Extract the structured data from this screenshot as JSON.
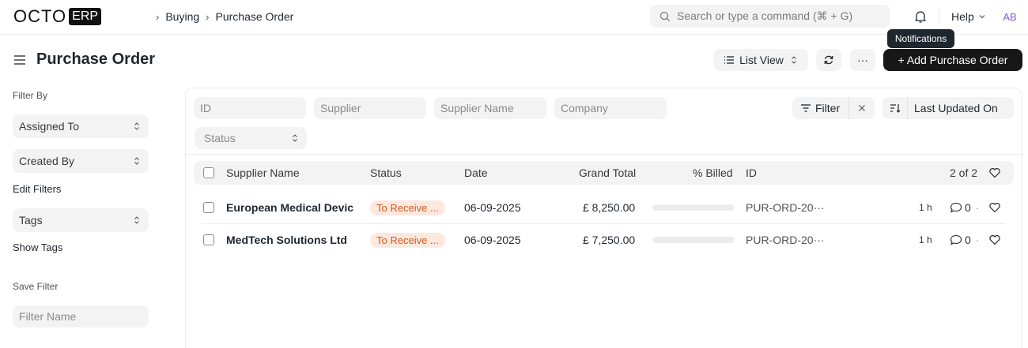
{
  "navbar": {
    "logo_text": "OCTO",
    "logo_badge": "ERP",
    "breadcrumbs": [
      "Buying",
      "Purchase Order"
    ],
    "search_placeholder": "Search or type a command (⌘ + G)",
    "help_label": "Help",
    "avatar_initials": "AB",
    "tooltip": "Notifications"
  },
  "header": {
    "title": "Purchase Order",
    "list_view_label": "List View",
    "more_label": "···",
    "add_button_label": "+ Add Purchase Order"
  },
  "sidebar": {
    "filter_by_label": "Filter By",
    "assigned_to": "Assigned To",
    "created_by": "Created By",
    "edit_filters": "Edit Filters",
    "tags": "Tags",
    "show_tags": "Show Tags",
    "save_filter_label": "Save Filter",
    "filter_name_placeholder": "Filter Name"
  },
  "filters": {
    "id_placeholder": "ID",
    "supplier_placeholder": "Supplier",
    "supplier_name_placeholder": "Supplier Name",
    "company_placeholder": "Company",
    "status_placeholder": "Status",
    "filter_label": "Filter",
    "sort_label": "Last Updated On"
  },
  "list": {
    "columns": {
      "supplier_name": "Supplier Name",
      "status": "Status",
      "date": "Date",
      "grand_total": "Grand Total",
      "billed": "% Billed",
      "id": "ID"
    },
    "count": "2 of 2",
    "rows": [
      {
        "supplier_name": "European Medical Devic",
        "status": "To Receive ...",
        "date": "06-09-2025",
        "grand_total": "£ 8,250.00",
        "billed_pct": 0,
        "id": "PUR-ORD-20···",
        "modified": "1 h",
        "comments": "0"
      },
      {
        "supplier_name": "MedTech Solutions Ltd",
        "status": "To Receive ...",
        "date": "06-09-2025",
        "grand_total": "£ 7,250.00",
        "billed_pct": 0,
        "id": "PUR-ORD-20···",
        "modified": "1 h",
        "comments": "0"
      }
    ]
  },
  "colors": {
    "primary_button": "#171717",
    "status_pill_bg": "#fde8dd",
    "status_pill_text": "#d15a24",
    "avatar_text": "#7c5bd5"
  }
}
